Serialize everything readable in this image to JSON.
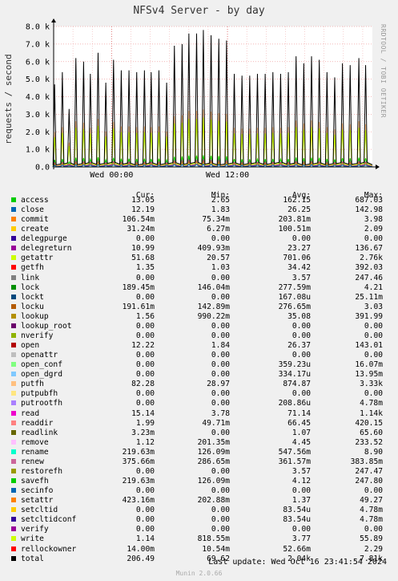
{
  "chart_data": {
    "type": "line",
    "title": "NFSv4 Server - by day",
    "ylabel": "requests / second",
    "side_text": "RRDTOOL / TOBI OETIKER",
    "ylim": [
      0,
      8000
    ],
    "y_ticks": [
      {
        "value": 0,
        "label": "0.0"
      },
      {
        "value": 1000,
        "label": "1.0 k"
      },
      {
        "value": 2000,
        "label": "2.0 k"
      },
      {
        "value": 3000,
        "label": "3.0 k"
      },
      {
        "value": 4000,
        "label": "4.0 k"
      },
      {
        "value": 5000,
        "label": "5.0 k"
      },
      {
        "value": 6000,
        "label": "6.0 k"
      },
      {
        "value": 7000,
        "label": "7.0 k"
      },
      {
        "value": 8000,
        "label": "8.0 k"
      }
    ],
    "x_ticks": [
      {
        "hour": 6,
        "label": "Wed 00:00"
      },
      {
        "hour": 18,
        "label": "Wed 12:00"
      }
    ],
    "xlim_hours": [
      0,
      33
    ],
    "total_series": {
      "name": "total",
      "color": "#000000",
      "peaks": [
        {
          "hour": 0.1,
          "value": 4700
        },
        {
          "hour": 0.9,
          "value": 5400
        },
        {
          "hour": 1.6,
          "value": 3300
        },
        {
          "hour": 2.3,
          "value": 6200
        },
        {
          "hour": 3.1,
          "value": 6000
        },
        {
          "hour": 3.8,
          "value": 5300
        },
        {
          "hour": 4.6,
          "value": 6500
        },
        {
          "hour": 5.4,
          "value": 4800
        },
        {
          "hour": 6.2,
          "value": 6100
        },
        {
          "hour": 7.0,
          "value": 5500
        },
        {
          "hour": 7.8,
          "value": 5500
        },
        {
          "hour": 8.6,
          "value": 5400
        },
        {
          "hour": 9.4,
          "value": 5500
        },
        {
          "hour": 10.1,
          "value": 5400
        },
        {
          "hour": 10.9,
          "value": 5500
        },
        {
          "hour": 11.7,
          "value": 4800
        },
        {
          "hour": 12.5,
          "value": 6900
        },
        {
          "hour": 13.3,
          "value": 7000
        },
        {
          "hour": 14.0,
          "value": 7600
        },
        {
          "hour": 14.8,
          "value": 7600
        },
        {
          "hour": 15.5,
          "value": 7800
        },
        {
          "hour": 16.3,
          "value": 7500
        },
        {
          "hour": 17.1,
          "value": 7300
        },
        {
          "hour": 17.9,
          "value": 7200
        },
        {
          "hour": 18.7,
          "value": 5300
        },
        {
          "hour": 19.5,
          "value": 5200
        },
        {
          "hour": 20.3,
          "value": 5200
        },
        {
          "hour": 21.1,
          "value": 5300
        },
        {
          "hour": 21.9,
          "value": 5300
        },
        {
          "hour": 22.7,
          "value": 5400
        },
        {
          "hour": 23.5,
          "value": 5300
        },
        {
          "hour": 24.3,
          "value": 5400
        },
        {
          "hour": 25.1,
          "value": 6300
        },
        {
          "hour": 25.9,
          "value": 5900
        },
        {
          "hour": 26.7,
          "value": 6300
        },
        {
          "hour": 27.5,
          "value": 6100
        },
        {
          "hour": 28.3,
          "value": 5400
        },
        {
          "hour": 29.1,
          "value": 5100
        },
        {
          "hour": 29.9,
          "value": 5900
        },
        {
          "hour": 30.7,
          "value": 5800
        },
        {
          "hour": 31.6,
          "value": 6200
        },
        {
          "hour": 32.3,
          "value": 5800
        }
      ]
    },
    "legend_header": {
      "cur": "Cur:",
      "min": "Min:",
      "avg": "Avg:",
      "max": "Max:"
    },
    "series": [
      {
        "name": "access",
        "color": "#00cc00",
        "cur": "13.05",
        "min": "2.65",
        "avg": "162.15",
        "max": "687.03"
      },
      {
        "name": "close",
        "color": "#0066b3",
        "cur": "12.19",
        "min": "1.83",
        "avg": "26.25",
        "max": "142.98"
      },
      {
        "name": "commit",
        "color": "#ff8000",
        "cur": "106.54m",
        "min": "75.34m",
        "avg": "203.81m",
        "max": "3.98"
      },
      {
        "name": "create",
        "color": "#ffcc00",
        "cur": "31.24m",
        "min": "6.27m",
        "avg": "100.51m",
        "max": "2.09"
      },
      {
        "name": "delegpurge",
        "color": "#330099",
        "cur": "0.00",
        "min": "0.00",
        "avg": "0.00",
        "max": "0.00"
      },
      {
        "name": "delegreturn",
        "color": "#990099",
        "cur": "10.99",
        "min": "409.93m",
        "avg": "23.27",
        "max": "136.67"
      },
      {
        "name": "getattr",
        "color": "#ccff00",
        "cur": "51.68",
        "min": "20.57",
        "avg": "701.06",
        "max": "2.76k"
      },
      {
        "name": "getfh",
        "color": "#ff0000",
        "cur": "1.35",
        "min": "1.03",
        "avg": "34.42",
        "max": "392.03"
      },
      {
        "name": "link",
        "color": "#808080",
        "cur": "0.00",
        "min": "0.00",
        "avg": "3.57",
        "max": "247.46"
      },
      {
        "name": "lock",
        "color": "#008f00",
        "cur": "189.45m",
        "min": "146.04m",
        "avg": "277.59m",
        "max": "4.21"
      },
      {
        "name": "lockt",
        "color": "#00487d",
        "cur": "0.00",
        "min": "0.00",
        "avg": "167.08u",
        "max": "25.11m"
      },
      {
        "name": "locku",
        "color": "#b35a00",
        "cur": "191.61m",
        "min": "142.89m",
        "avg": "276.65m",
        "max": "3.03"
      },
      {
        "name": "lookup",
        "color": "#b38f00",
        "cur": "1.56",
        "min": "990.22m",
        "avg": "35.08",
        "max": "391.99"
      },
      {
        "name": "lookup_root",
        "color": "#6b006b",
        "cur": "0.00",
        "min": "0.00",
        "avg": "0.00",
        "max": "0.00"
      },
      {
        "name": "nverify",
        "color": "#8fb300",
        "cur": "0.00",
        "min": "0.00",
        "avg": "0.00",
        "max": "0.00"
      },
      {
        "name": "open",
        "color": "#b30000",
        "cur": "12.22",
        "min": "1.84",
        "avg": "26.37",
        "max": "143.01"
      },
      {
        "name": "openattr",
        "color": "#bebebe",
        "cur": "0.00",
        "min": "0.00",
        "avg": "0.00",
        "max": "0.00"
      },
      {
        "name": "open_conf",
        "color": "#80ff80",
        "cur": "0.00",
        "min": "0.00",
        "avg": "359.23u",
        "max": "16.07m"
      },
      {
        "name": "open_dgrd",
        "color": "#80c9ff",
        "cur": "0.00",
        "min": "0.00",
        "avg": "334.17u",
        "max": "13.95m"
      },
      {
        "name": "putfh",
        "color": "#ffc080",
        "cur": "82.28",
        "min": "28.97",
        "avg": "874.87",
        "max": "3.33k"
      },
      {
        "name": "putpubfh",
        "color": "#ffe680",
        "cur": "0.00",
        "min": "0.00",
        "avg": "0.00",
        "max": "0.00"
      },
      {
        "name": "putrootfh",
        "color": "#aa80ff",
        "cur": "0.00",
        "min": "0.00",
        "avg": "208.86u",
        "max": "4.78m"
      },
      {
        "name": "read",
        "color": "#ee00cc",
        "cur": "15.14",
        "min": "3.78",
        "avg": "71.14",
        "max": "1.14k"
      },
      {
        "name": "readdir",
        "color": "#ff8080",
        "cur": "1.99",
        "min": "49.71m",
        "avg": "66.45",
        "max": "420.15"
      },
      {
        "name": "readlink",
        "color": "#666600",
        "cur": "3.23m",
        "min": "0.00",
        "avg": "1.07",
        "max": "65.60"
      },
      {
        "name": "remove",
        "color": "#ffbfff",
        "cur": "1.12",
        "min": "201.35m",
        "avg": "4.45",
        "max": "233.52"
      },
      {
        "name": "rename",
        "color": "#00ffcc",
        "cur": "219.63m",
        "min": "126.09m",
        "avg": "547.56m",
        "max": "8.90"
      },
      {
        "name": "renew",
        "color": "#cc6699",
        "cur": "375.66m",
        "min": "286.65m",
        "avg": "361.57m",
        "max": "383.85m"
      },
      {
        "name": "restorefh",
        "color": "#999900",
        "cur": "0.00",
        "min": "0.00",
        "avg": "3.57",
        "max": "247.47"
      },
      {
        "name": "savefh",
        "color": "#00cc00",
        "cur": "219.63m",
        "min": "126.09m",
        "avg": "4.12",
        "max": "247.80"
      },
      {
        "name": "secinfo",
        "color": "#0066b3",
        "cur": "0.00",
        "min": "0.00",
        "avg": "0.00",
        "max": "0.00"
      },
      {
        "name": "setattr",
        "color": "#ff8000",
        "cur": "423.16m",
        "min": "202.88m",
        "avg": "1.37",
        "max": "49.27"
      },
      {
        "name": "setcltid",
        "color": "#ffcc00",
        "cur": "0.00",
        "min": "0.00",
        "avg": "83.54u",
        "max": "4.78m"
      },
      {
        "name": "setcltidconf",
        "color": "#330099",
        "cur": "0.00",
        "min": "0.00",
        "avg": "83.54u",
        "max": "4.78m"
      },
      {
        "name": "verify",
        "color": "#990099",
        "cur": "0.00",
        "min": "0.00",
        "avg": "0.00",
        "max": "0.00"
      },
      {
        "name": "write",
        "color": "#ccff00",
        "cur": "1.14",
        "min": "818.55m",
        "avg": "3.77",
        "max": "55.89"
      },
      {
        "name": "rellockowner",
        "color": "#ff0000",
        "cur": "14.00m",
        "min": "10.54m",
        "avg": "52.66m",
        "max": "2.29"
      },
      {
        "name": "total",
        "color": "#000000",
        "cur": "206.49",
        "min": "69.62",
        "avg": "2.04k",
        "max": "7.81k"
      }
    ]
  },
  "footer": {
    "last_update": "Last update: Wed Oct 16 23:41:54 2024",
    "munin": "Munin 2.0.66"
  }
}
